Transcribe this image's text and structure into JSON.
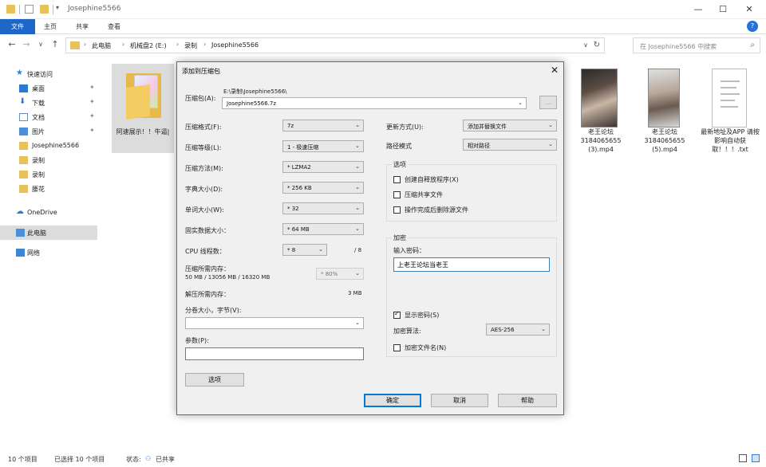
{
  "window": {
    "title": "Josephine5566",
    "minimize_glyph": "—",
    "maximize_glyph": "☐",
    "close_glyph": "✕"
  },
  "ribbon": {
    "tabs": [
      "文件",
      "主页",
      "共享",
      "查看"
    ],
    "expand_glyph": "?"
  },
  "nav": {
    "back_glyph": "←",
    "forward_glyph": "→",
    "down_glyph": "∨",
    "up_glyph": "↑",
    "breadcrumb": [
      "此电脑",
      "机械盘2 (E:)",
      "录制",
      "Josephine5566"
    ],
    "crumb_sep": "›",
    "search_placeholder": "在 Josephine5566 中搜索"
  },
  "sidebar": {
    "items": [
      {
        "label": "快速访问",
        "icon": "star-icon"
      },
      {
        "label": "桌面",
        "icon": "desktop-icon",
        "pinned": true
      },
      {
        "label": "下载",
        "icon": "download-icon",
        "pinned": true
      },
      {
        "label": "文档",
        "icon": "document-icon",
        "pinned": true
      },
      {
        "label": "图片",
        "icon": "picture-icon",
        "pinned": true
      },
      {
        "label": "Josephine5566",
        "icon": "folder-icon"
      },
      {
        "label": "录制",
        "icon": "folder-icon"
      },
      {
        "label": "录制",
        "icon": "folder-icon"
      },
      {
        "label": "腰花",
        "icon": "folder-icon"
      },
      {
        "label": "OneDrive",
        "icon": "cloud-icon"
      },
      {
        "label": "此电脑",
        "icon": "computer-icon",
        "selected": true
      },
      {
        "label": "网络",
        "icon": "network-icon"
      }
    ]
  },
  "files": [
    {
      "label": "阿速展示！！牛逼|",
      "type": "folder",
      "selected": true
    },
    {
      "label": "老王论坛 3184065655 (3).mp4",
      "type": "video"
    },
    {
      "label": "老王论坛 3184065655 (5).mp4",
      "type": "video"
    },
    {
      "label": "最新地址及APP 请按影响自动获取！！！.txt",
      "type": "text"
    }
  ],
  "status": {
    "count": "10 个项目",
    "selected": "已选择 10 个项目",
    "state_label": "状态:",
    "state_value": "已共享"
  },
  "dialog": {
    "title": "添加到压缩包",
    "close_glyph": "✕",
    "archive_label": "压缩包(A):",
    "archive_path": "E:\\录制\\Josephine5566\\",
    "archive_name": "Josephine5566.7z",
    "browse_label": "...",
    "format_label": "压缩格式(F):",
    "format_value": "7z",
    "level_label": "压缩等级(L):",
    "level_value": "1 - 极速压缩",
    "method_label": "压缩方法(M):",
    "method_value": "* LZMA2",
    "dict_label": "字典大小(D):",
    "dict_value": "* 256 KB",
    "word_label": "单词大小(W):",
    "word_value": "* 32",
    "solid_label": "固实数据大小：",
    "solid_value": "* 64 MB",
    "cpu_label": "CPU 线程数：",
    "cpu_value": "* 8",
    "cpu_total": "/ 8",
    "mem_label": "压缩所需内存：",
    "mem_value": "50 MB / 13056 MB / 16320 MB",
    "mem_percent": "* 80%",
    "decomp_label": "解压所需内存：",
    "decomp_value": "3 MB",
    "split_label": "分卷大小，字节(V):",
    "split_value": "",
    "params_label": "参数(P):",
    "params_value": "",
    "options_button": "选项",
    "update_label": "更新方式(U):",
    "update_value": "添加并替换文件",
    "path_label": "路径模式",
    "path_value": "相对路径",
    "options_group": "选项",
    "opt_sfx": "创建自释放程序(X)",
    "opt_shared": "压缩共享文件",
    "opt_delete": "操作完成后删除源文件",
    "enc_group": "加密",
    "password_label": "输入密码：",
    "password_value": "上老王论坛当老王",
    "show_password": "显示密码(S)",
    "enc_method_label": "加密算法:",
    "enc_method_value": "AES-256",
    "encrypt_names": "加密文件名(N)",
    "ok_button": "确定",
    "cancel_button": "取消",
    "help_button": "帮助"
  }
}
